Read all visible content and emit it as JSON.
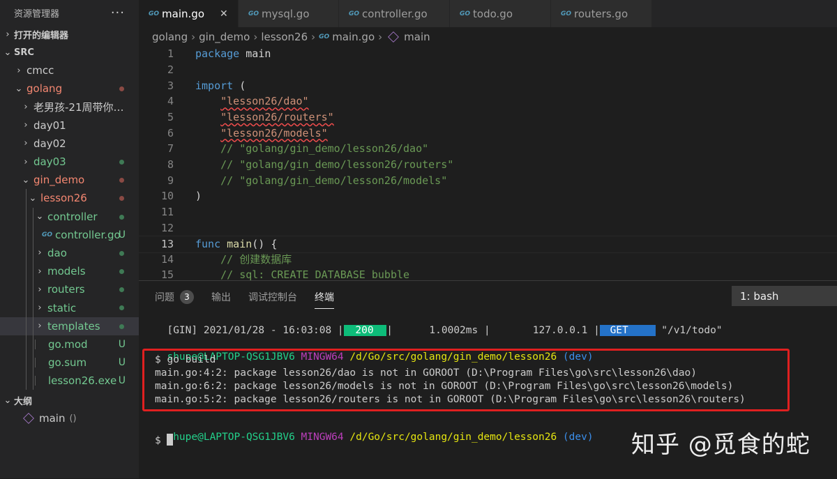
{
  "explorer": {
    "title": "资源管理器",
    "more": "···",
    "open_editors": "打开的编辑器",
    "section_src": "SRC",
    "items": [
      {
        "label": "cmcc",
        "indent": 0,
        "type": "folder",
        "open": false,
        "color": "#cccccc",
        "status": ""
      },
      {
        "label": "golang",
        "indent": 0,
        "type": "folder",
        "open": true,
        "color": "#f48771",
        "status": "dot-red"
      },
      {
        "label": "老男孩-21周带你搞...",
        "indent": 1,
        "type": "folder",
        "open": false,
        "color": "#cccccc",
        "status": ""
      },
      {
        "label": "day01",
        "indent": 1,
        "type": "folder",
        "open": false,
        "color": "#cccccc",
        "status": ""
      },
      {
        "label": "day02",
        "indent": 1,
        "type": "folder",
        "open": false,
        "color": "#cccccc",
        "status": ""
      },
      {
        "label": "day03",
        "indent": 1,
        "type": "folder",
        "open": false,
        "color": "#73c991",
        "status": "dot-green"
      },
      {
        "label": "gin_demo",
        "indent": 1,
        "type": "folder",
        "open": true,
        "color": "#f48771",
        "status": "dot-red"
      },
      {
        "label": "lesson26",
        "indent": 2,
        "type": "folder",
        "open": true,
        "color": "#f48771",
        "status": "dot-red"
      },
      {
        "label": "controller",
        "indent": 3,
        "type": "folder",
        "open": true,
        "color": "#73c991",
        "status": "dot-green"
      },
      {
        "label": "controller.go",
        "indent": 4,
        "type": "go",
        "open": false,
        "color": "#73c991",
        "status": "U"
      },
      {
        "label": "dao",
        "indent": 3,
        "type": "folder",
        "open": false,
        "color": "#73c991",
        "status": "dot-green"
      },
      {
        "label": "models",
        "indent": 3,
        "type": "folder",
        "open": false,
        "color": "#73c991",
        "status": "dot-green"
      },
      {
        "label": "routers",
        "indent": 3,
        "type": "folder",
        "open": false,
        "color": "#73c991",
        "status": "dot-green"
      },
      {
        "label": "static",
        "indent": 3,
        "type": "folder",
        "open": false,
        "color": "#73c991",
        "status": "dot-green"
      },
      {
        "label": "templates",
        "indent": 3,
        "type": "folder",
        "open": false,
        "color": "#73c991",
        "status": "dot-green",
        "selected": true
      },
      {
        "label": "go.mod",
        "indent": 3,
        "type": "file",
        "open": false,
        "color": "#73c991",
        "status": "U"
      },
      {
        "label": "go.sum",
        "indent": 3,
        "type": "file",
        "open": false,
        "color": "#73c991",
        "status": "U"
      },
      {
        "label": "lesson26.exe",
        "indent": 3,
        "type": "file",
        "open": false,
        "color": "#73c991",
        "status": "U"
      }
    ],
    "outline_title": "大纲",
    "outline_item": "main",
    "outline_item_suffix": "()"
  },
  "tabs": [
    {
      "label": "main.go",
      "active": true,
      "close": "✕"
    },
    {
      "label": "mysql.go",
      "active": false
    },
    {
      "label": "controller.go",
      "active": false
    },
    {
      "label": "todo.go",
      "active": false
    },
    {
      "label": "routers.go",
      "active": false
    }
  ],
  "breadcrumb": [
    "golang",
    "gin_demo",
    "lesson26",
    "main.go",
    "main"
  ],
  "code_lines": [
    {
      "n": "1",
      "tokens": [
        [
          "kw",
          "package"
        ],
        [
          "pl",
          " main"
        ]
      ]
    },
    {
      "n": "2",
      "tokens": []
    },
    {
      "n": "3",
      "tokens": [
        [
          "kw",
          "import"
        ],
        [
          "pl",
          " ("
        ]
      ]
    },
    {
      "n": "4",
      "tokens": [
        [
          "pl",
          "    "
        ],
        [
          "str squig",
          "\"lesson26/dao\""
        ]
      ]
    },
    {
      "n": "5",
      "tokens": [
        [
          "pl",
          "    "
        ],
        [
          "str squig",
          "\"lesson26/routers\""
        ]
      ]
    },
    {
      "n": "6",
      "tokens": [
        [
          "pl",
          "    "
        ],
        [
          "str squig",
          "\"lesson26/models\""
        ]
      ]
    },
    {
      "n": "7",
      "tokens": [
        [
          "cm",
          "    // \"golang/gin_demo/lesson26/dao\""
        ]
      ]
    },
    {
      "n": "8",
      "tokens": [
        [
          "cm",
          "    // \"golang/gin_demo/lesson26/routers\""
        ]
      ]
    },
    {
      "n": "9",
      "tokens": [
        [
          "cm",
          "    // \"golang/gin_demo/lesson26/models\""
        ]
      ]
    },
    {
      "n": "10",
      "tokens": [
        [
          "pl",
          ")"
        ]
      ]
    },
    {
      "n": "11",
      "tokens": []
    },
    {
      "n": "12",
      "tokens": []
    },
    {
      "n": "13",
      "tokens": [
        [
          "kw",
          "func"
        ],
        [
          "pl",
          " "
        ],
        [
          "fn",
          "main"
        ],
        [
          "pl",
          "() {"
        ]
      ],
      "current": true
    },
    {
      "n": "14",
      "tokens": [
        [
          "cm",
          "    // 创建数据库"
        ]
      ]
    },
    {
      "n": "15",
      "tokens": [
        [
          "cm",
          "    // sql: CREATE DATABASE bubble"
        ]
      ]
    }
  ],
  "panel": {
    "tabs": [
      {
        "label": "问题",
        "count": "3",
        "active": false
      },
      {
        "label": "输出",
        "active": false
      },
      {
        "label": "调试控制台",
        "active": false
      },
      {
        "label": "终端",
        "active": true
      }
    ],
    "terminal_select": "1: bash"
  },
  "terminal": {
    "gin_prefix": "[GIN] 2021/01/28 - 16:03:08 |",
    "gin_status": " 200 ",
    "gin_mid": "|      1.0002ms |       127.0.0.1 |",
    "gin_method": " GET ",
    "gin_path": " \"/v1/todo\"",
    "prompt_user": "shupe@LAPTOP-QSG1JBV6",
    "prompt_env": "MINGW64",
    "prompt_path": "/d/Go/src/golang/gin_demo/lesson26",
    "prompt_branch": "(dev)",
    "cmd": "$ go build",
    "errors": [
      "main.go:4:2: package lesson26/dao is not in GOROOT (D:\\Program Files\\go\\src\\lesson26\\dao)",
      "main.go:6:2: package lesson26/models is not in GOROOT (D:\\Program Files\\go\\src\\lesson26\\models)",
      "main.go:5:2: package lesson26/routers is not in GOROOT (D:\\Program Files\\go\\src\\lesson26\\routers)"
    ],
    "prompt_dollar": "$ "
  },
  "watermark": "知乎 @觅食的蛇",
  "colors": {
    "accent": "#007acc",
    "error": "#e02020",
    "green": "#73c991",
    "red": "#f48771"
  }
}
